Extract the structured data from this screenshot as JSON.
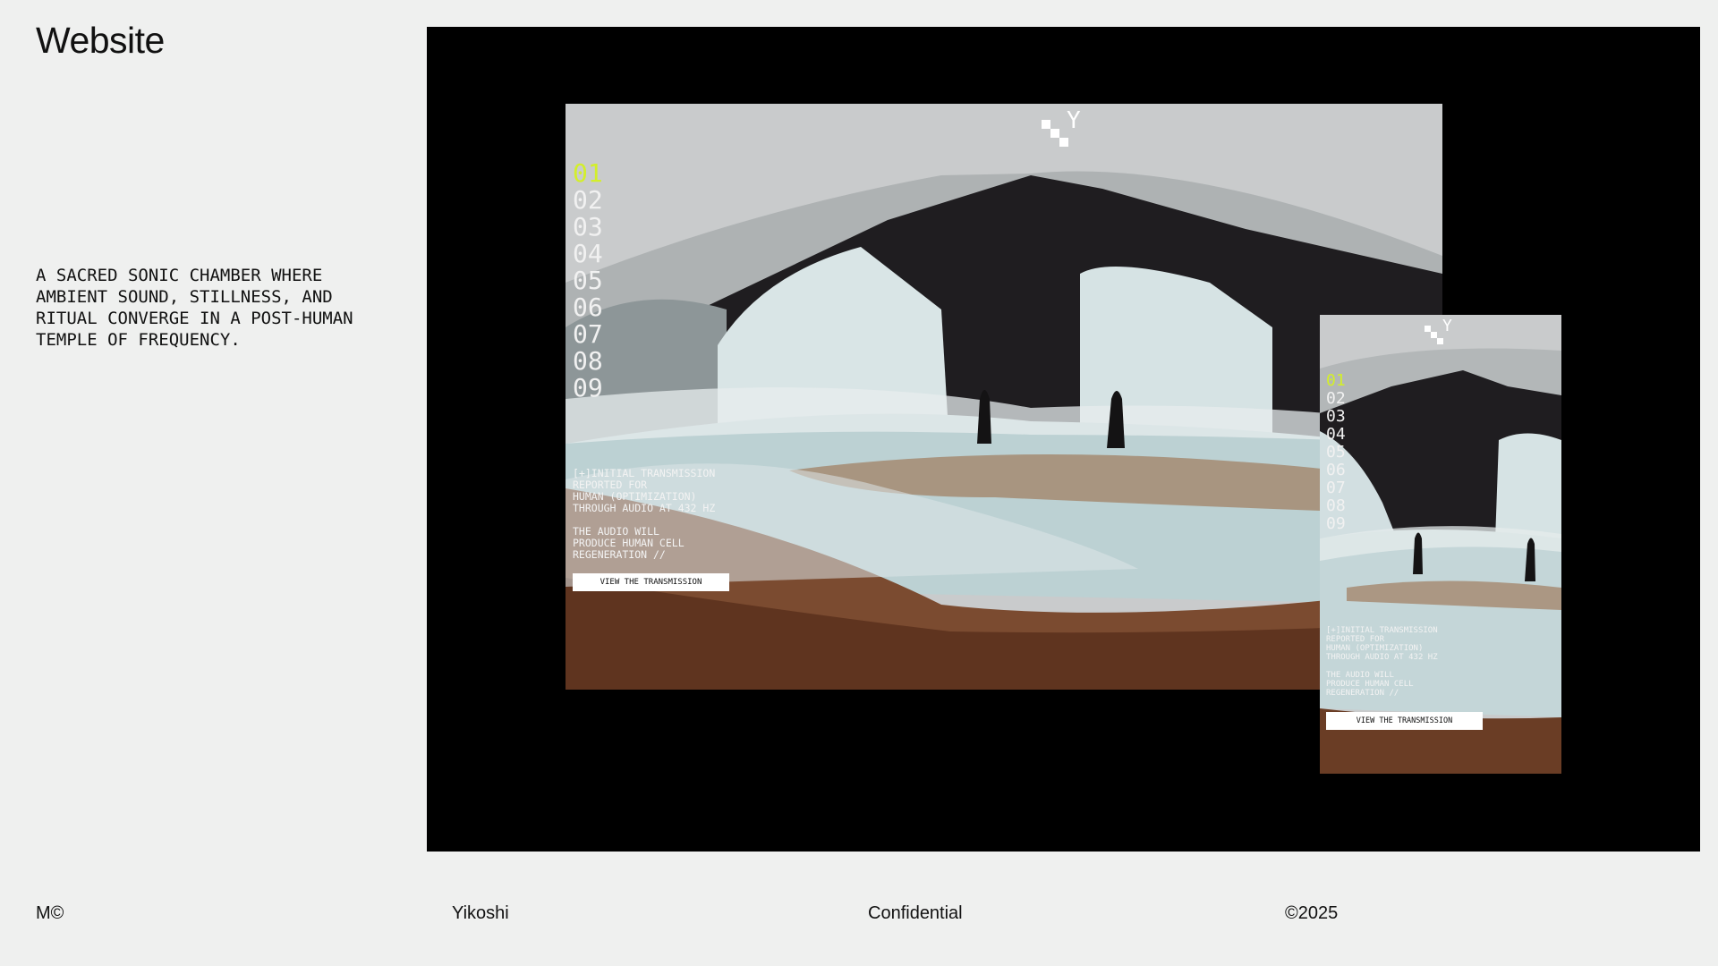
{
  "page": {
    "title": "Website",
    "intro": "A SACRED SONIC CHAMBER WHERE\nAMBIENT SOUND, STILLNESS, AND\nRITUAL CONVERGE IN A POST-HUMAN\nTEMPLE OF FREQUENCY."
  },
  "desktop_preview": {
    "logo_letter": "Y",
    "nav_numbers": [
      "01",
      "02",
      "03",
      "04",
      "05",
      "06",
      "07",
      "08",
      "09"
    ],
    "active_index": 0,
    "copy_1": "[+]INITIAL TRANSMISSION\nREPORTED FOR\nHUMAN (OPTIMIZATION)\nTHROUGH AUDIO AT 432 HZ",
    "copy_2": "THE AUDIO WILL\nPRODUCE HUMAN CELL\nREGENERATION //",
    "cta": "VIEW THE TRANSMISSION"
  },
  "mobile_preview": {
    "logo_letter": "Y",
    "nav_numbers": [
      "01",
      "02",
      "03",
      "04",
      "05",
      "06",
      "07",
      "08",
      "09"
    ],
    "active_index": 0,
    "copy_1": "[+]INITIAL TRANSMISSION\nREPORTED FOR\nHUMAN (OPTIMIZATION)\nTHROUGH AUDIO AT 432 HZ",
    "copy_2": "THE AUDIO WILL\nPRODUCE HUMAN CELL\nREGENERATION //",
    "cta": "VIEW THE TRANSMISSION"
  },
  "footer": {
    "left": "M©",
    "client": "Yikoshi",
    "status": "Confidential",
    "year": "©2025"
  },
  "colors": {
    "background": "#eff0ef",
    "stage": "#000000",
    "accent": "#d3ef2a",
    "text": "#111111"
  }
}
